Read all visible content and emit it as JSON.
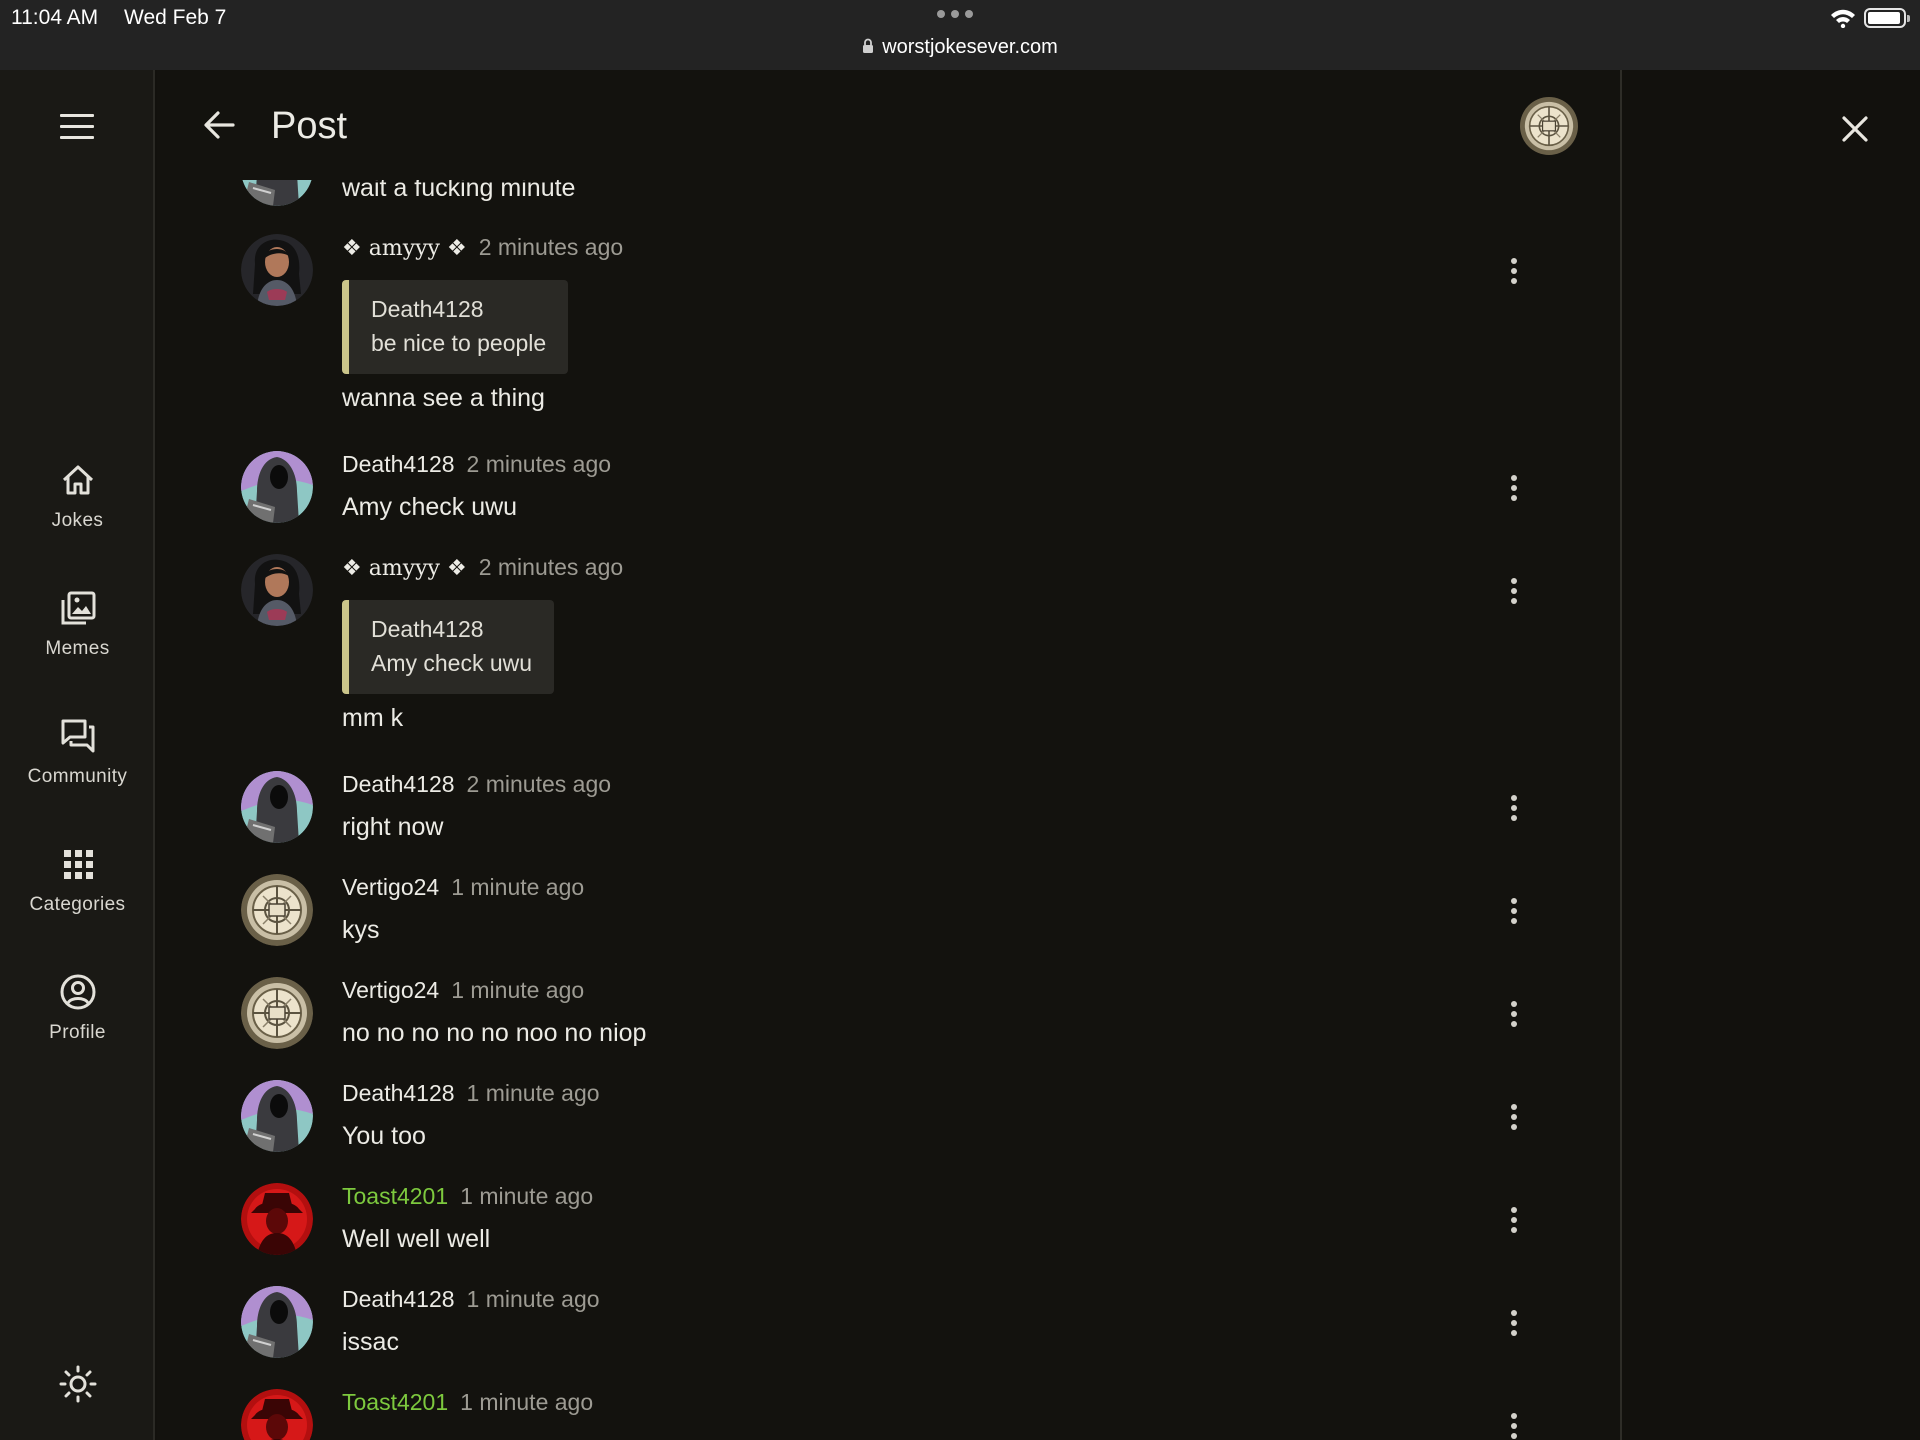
{
  "status_bar": {
    "time": "11:04 AM",
    "date": "Wed Feb 7",
    "url": "worstjokesever.com"
  },
  "sidebar": {
    "items": [
      {
        "label": "Jokes",
        "icon": "home-icon"
      },
      {
        "label": "Memes",
        "icon": "images-icon"
      },
      {
        "label": "Community",
        "icon": "chat-icon"
      },
      {
        "label": "Categories",
        "icon": "grid-icon"
      },
      {
        "label": "Profile",
        "icon": "user-circle-icon"
      }
    ],
    "theme_icon": "sun-icon",
    "menu_icon": "hamburger-menu-icon"
  },
  "header": {
    "title": "Post",
    "back_icon": "arrow-left-icon",
    "close_icon": "close-icon"
  },
  "comments": [
    {
      "text": "wait a fucking minute"
    },
    {
      "user": "❖ amyyy ❖",
      "time": "2 minutes ago",
      "quote_user": "Death4128",
      "quote_text": "be nice to people",
      "text": "wanna see a thing"
    },
    {
      "user": "Death4128",
      "time": "2 minutes ago",
      "text": "Amy check uwu"
    },
    {
      "user": "❖ amyyy ❖",
      "time": "2 minutes ago",
      "quote_user": "Death4128",
      "quote_text": "Amy check uwu",
      "text": "mm k"
    },
    {
      "user": "Death4128",
      "time": "2 minutes ago",
      "text": "right now"
    },
    {
      "user": "Vertigo24",
      "time": "1 minute ago",
      "text": "kys"
    },
    {
      "user": "Vertigo24",
      "time": "1 minute ago",
      "text": "no no no no no noo no niop"
    },
    {
      "user": "Death4128",
      "time": "1 minute ago",
      "text": "You too"
    },
    {
      "user": "Toast4201",
      "time": "1 minute ago",
      "text": "Well well well"
    },
    {
      "user": "Death4128",
      "time": "1 minute ago",
      "text": "issac"
    },
    {
      "user": "Toast4201",
      "time": "1 minute ago",
      "text": ""
    }
  ],
  "colors": {
    "background": "#13120e",
    "sidebar": "#1a1915",
    "quote_bar": "#cbc58a",
    "highlight_user": "#7dc93e",
    "muted_text": "#9d9b93"
  }
}
